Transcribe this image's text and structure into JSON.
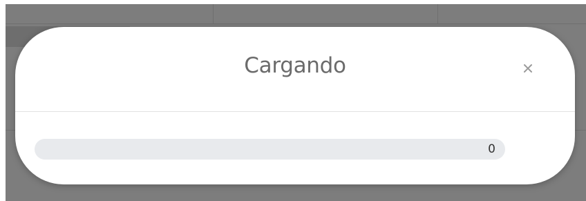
{
  "dialog": {
    "title": "Cargando",
    "close_icon": "close-icon"
  },
  "progress": {
    "value_label": "0",
    "fraction": 0
  },
  "colors": {
    "backdrop": "#7d7d7d",
    "title_text": "#6b6b6b",
    "track": "#e8eaed"
  }
}
